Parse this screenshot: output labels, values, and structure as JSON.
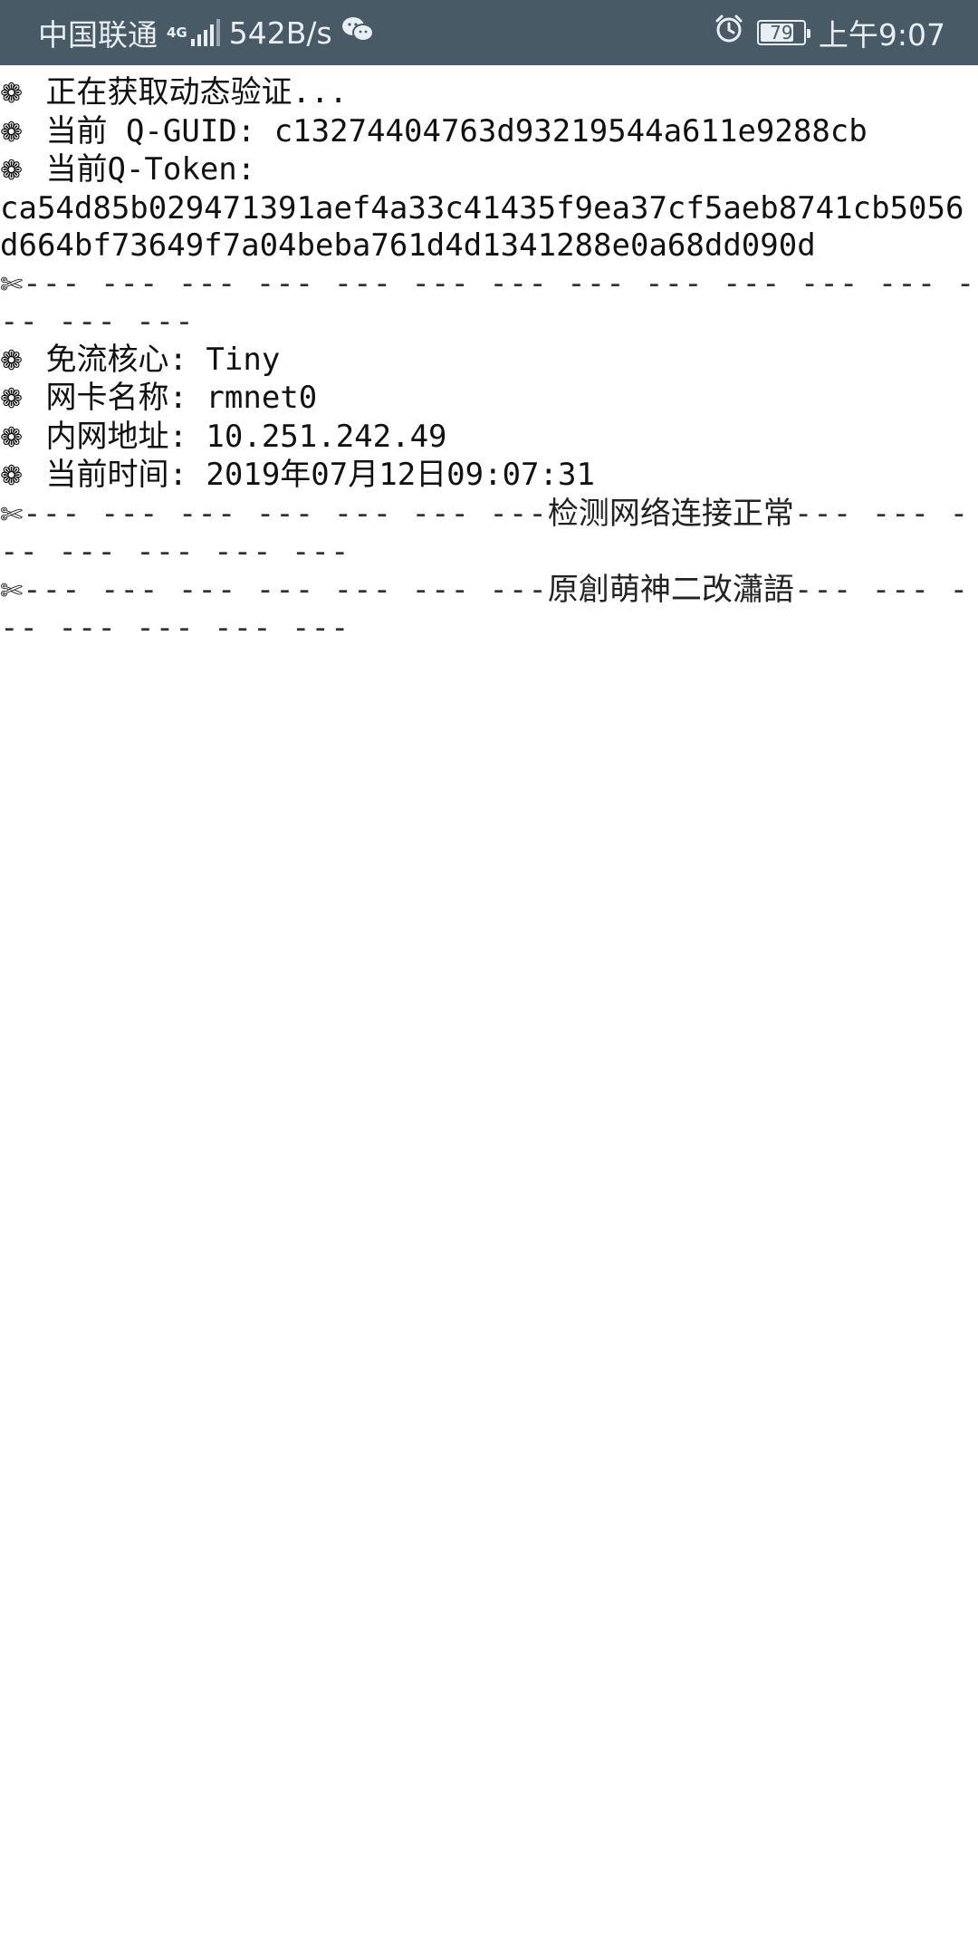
{
  "status_bar": {
    "carrier": "中国联通",
    "network_type": "4G",
    "net_speed": "542B/s",
    "battery_level": "79",
    "time": "上午9:07",
    "icons": [
      "signal-icon",
      "wechat-icon",
      "alarm-icon",
      "battery-icon"
    ]
  },
  "terminal": {
    "bullet_char": "❁",
    "scissor_char": "✄",
    "lines": {
      "fetching": "正在获取动态验证...",
      "guid": "当前 Q-GUID: c13274404763d93219544a611e9288cb",
      "token_label": "当前Q-Token:",
      "token_value": "ca54d85b029471391aef4a33c41435f9ea37cf5aeb8741cb5056d664bf73649f7a04beba761d4d1341288e0a68dd090d",
      "core": "免流核心: Tiny",
      "nic": "网卡名称: rmnet0",
      "ip": "内网地址: 10.251.242.49",
      "time": "当前时间: 2019年07月12日09:07:31"
    },
    "separator_plain": "--- --- --- --- --- --- --- --- --- --- --- --- --- --- ---",
    "sep_prefix": "--- --- --- --- --- --- ---",
    "sep_suffix": "--- --- --- --- --- --- ---",
    "network_ok": "检测网络连接正常",
    "credit": "原創萌神二改瀟語"
  }
}
